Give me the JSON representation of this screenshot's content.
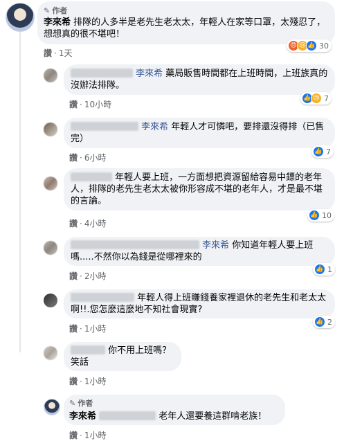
{
  "author_badge": "作者",
  "comments": [
    {
      "name": "李來希",
      "text": "排隊的人多半是老先生老太太，年輕人在家等口罩，太殘忍了，想想真的很不堪吧！",
      "action": "讚",
      "time": "1天",
      "reactions": [
        "angry",
        "sad",
        "like"
      ],
      "count": "30"
    },
    {
      "name": "李來希",
      "text": "藥局販售時間都在上班時間，上班族真的沒辦法排隊。",
      "action": "讚",
      "time": "10小時",
      "reactions": [
        "like",
        "sad"
      ],
      "count": "7"
    },
    {
      "name": "李來希",
      "text": "年輕人才可憐吧，要排還沒得排（已售完）",
      "action": "讚",
      "time": "6小時",
      "reactions": [
        "like"
      ],
      "count": "7"
    },
    {
      "text": "年輕人要上班，一方面想把資源留給容易中鏢的老年人，排隊的老先生老太太被你形容成不堪的老年人，才是最不堪的言論。",
      "action": "讚",
      "time": "4小時",
      "reactions": [
        "like"
      ],
      "count": "10"
    },
    {
      "name": "李來希",
      "text": "你知道年輕人要上班嗎.....不然你以為錢是從哪裡來的",
      "action": "讚",
      "time": "2小時",
      "reactions": [
        "like"
      ],
      "count": "1"
    },
    {
      "text": "年輕人得上班賺錢養家裡退休的老先生和老太太啊!!.您怎麼這麼地不知社會現實?",
      "action": "讚",
      "time": "1小時",
      "reactions": [
        "like"
      ],
      "count": "2"
    },
    {
      "text": "你不用上班嗎？",
      "text2": "笑話",
      "action": "讚",
      "time": "1小時"
    },
    {
      "name": "李來希",
      "text": "老年人還要養這群啃老族！",
      "action": "讚",
      "time": "1小時"
    }
  ]
}
